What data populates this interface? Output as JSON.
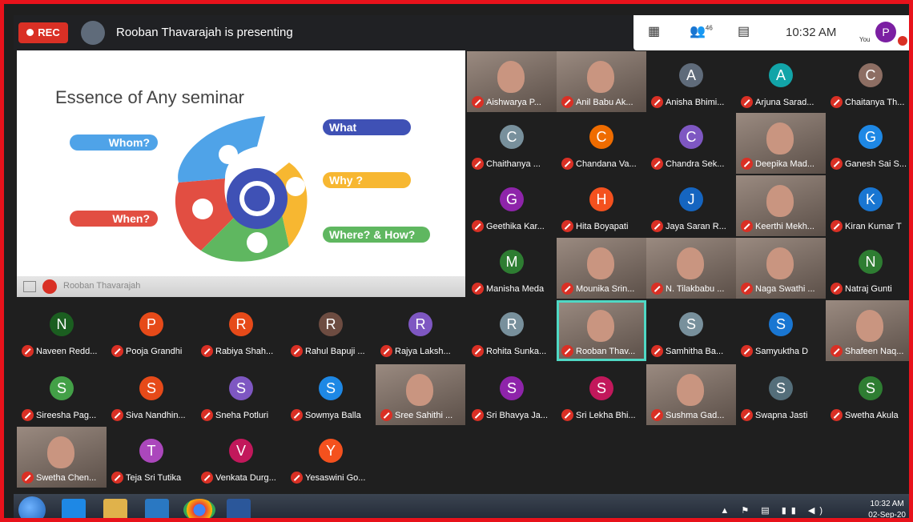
{
  "topbar": {
    "rec_label": "REC",
    "presenting_text": "Rooban Thavarajah is presenting",
    "participant_count": "46",
    "time": "10:32 AM",
    "you_label": "You",
    "user_initial": "P"
  },
  "slide": {
    "title": "Essence of Any seminar",
    "pills": {
      "whom": "Whom?",
      "when": "When?",
      "what": "What",
      "why": "Why ?",
      "where_how": "Where? & How?"
    },
    "presenter_name": "Rooban Thavarajah"
  },
  "tiles": [
    {
      "name": "Aishwarya P...",
      "type": "video"
    },
    {
      "name": "Anil Babu Ak...",
      "type": "video"
    },
    {
      "name": "Anisha Bhimi...",
      "initial": "A",
      "color": "#5f6b7a"
    },
    {
      "name": "Arjuna Sarad...",
      "initial": "A",
      "color": "#12a4a8"
    },
    {
      "name": "Chaitanya Th...",
      "initial": "C",
      "color": "#8d6e63"
    },
    {
      "name": "Chaithanya ...",
      "initial": "C",
      "color": "#78909c"
    },
    {
      "name": "Chandana Va...",
      "initial": "C",
      "color": "#ef6c00"
    },
    {
      "name": "Chandra Sek...",
      "initial": "C",
      "color": "#7e57c2"
    },
    {
      "name": "Deepika Mad...",
      "type": "video"
    },
    {
      "name": "Ganesh Sai S...",
      "initial": "G",
      "color": "#1e88e5"
    },
    {
      "name": "Geethika Kar...",
      "initial": "G",
      "color": "#8e24aa"
    },
    {
      "name": "Hita Boyapati",
      "initial": "H",
      "color": "#f4511e"
    },
    {
      "name": "Jaya Saran R...",
      "initial": "J",
      "color": "#1565c0"
    },
    {
      "name": "Keerthi Mekh...",
      "type": "video"
    },
    {
      "name": "Kiran Kumar T",
      "initial": "K",
      "color": "#1976d2"
    },
    {
      "name": "Manisha Meda",
      "initial": "M",
      "color": "#2e7d32"
    },
    {
      "name": "Mounika Srin...",
      "type": "video"
    },
    {
      "name": "N. Tilakbabu ...",
      "type": "video"
    },
    {
      "name": "Naga Swathi ...",
      "type": "video"
    },
    {
      "name": "Natraj Gunti",
      "initial": "N",
      "color": "#2e7d32"
    },
    {
      "name": "Naveen Redd...",
      "initial": "N",
      "color": "#1b5e20"
    },
    {
      "name": "Pooja Grandhi",
      "initial": "P",
      "color": "#e64a19"
    },
    {
      "name": "Rabiya Shah...",
      "initial": "R",
      "color": "#e64a19"
    },
    {
      "name": "Rahul Bapuji ...",
      "initial": "R",
      "color": "#6d4c41"
    },
    {
      "name": "Rajya Laksh...",
      "initial": "R",
      "color": "#7e57c2"
    },
    {
      "name": "Rohita Sunka...",
      "initial": "R",
      "color": "#78909c"
    },
    {
      "name": "Rooban Thav...",
      "type": "video",
      "speaking": true
    },
    {
      "name": "Samhitha Ba...",
      "initial": "S",
      "color": "#78909c"
    },
    {
      "name": "Samyuktha D",
      "initial": "S",
      "color": "#1976d2"
    },
    {
      "name": "Shafeen Naq...",
      "type": "video"
    },
    {
      "name": "Sireesha Pag...",
      "initial": "S",
      "color": "#43a047"
    },
    {
      "name": "Siva Nandhin...",
      "initial": "S",
      "color": "#e64a19"
    },
    {
      "name": "Sneha Potluri",
      "initial": "S",
      "color": "#7e57c2"
    },
    {
      "name": "Sowmya Balla",
      "initial": "S",
      "color": "#1e88e5"
    },
    {
      "name": "Sree Sahithi ...",
      "type": "video"
    },
    {
      "name": "Sri Bhavya Ja...",
      "initial": "S",
      "color": "#8e24aa"
    },
    {
      "name": "Sri Lekha Bhi...",
      "initial": "S",
      "color": "#c2185b"
    },
    {
      "name": "Sushma Gad...",
      "type": "video"
    },
    {
      "name": "Swapna Jasti",
      "initial": "S",
      "color": "#546e7a"
    },
    {
      "name": "Swetha Akula",
      "initial": "S",
      "color": "#2e7d32"
    },
    {
      "name": "Swetha Chen...",
      "type": "video"
    },
    {
      "name": "Teja Sri Tutika",
      "initial": "T",
      "color": "#ab47bc"
    },
    {
      "name": "Venkata Durg...",
      "initial": "V",
      "color": "#c2185b"
    },
    {
      "name": "Yesaswini Go...",
      "initial": "Y",
      "color": "#f4511e"
    }
  ],
  "taskbar": {
    "time": "10:32 AM",
    "date": "02-Sep-20"
  }
}
